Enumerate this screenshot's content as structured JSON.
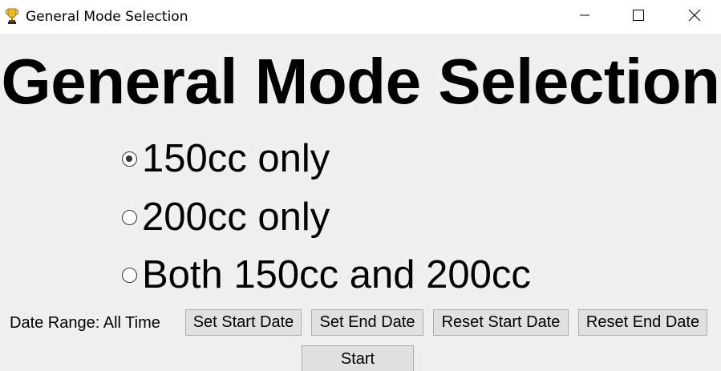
{
  "window": {
    "title": "General Mode Selection",
    "icon": "trophy-icon",
    "controls": {
      "minimize": "minimize-icon",
      "maximize": "maximize-icon",
      "close": "close-icon"
    }
  },
  "heading": "General Mode Selection",
  "modes": [
    {
      "label": "150cc only",
      "selected": true
    },
    {
      "label": "200cc only",
      "selected": false
    },
    {
      "label": "Both 150cc and 200cc",
      "selected": false
    }
  ],
  "date_range": {
    "label": "Date Range: All Time",
    "buttons": {
      "set_start": "Set Start Date",
      "set_end": "Set End Date",
      "reset_start": "Reset Start Date",
      "reset_end": "Reset End Date"
    }
  },
  "start_button": "Start",
  "colors": {
    "background": "#f0f0f0",
    "titlebar": "#ffffff",
    "button_face": "#e1e1e1",
    "button_border": "#adadad"
  }
}
